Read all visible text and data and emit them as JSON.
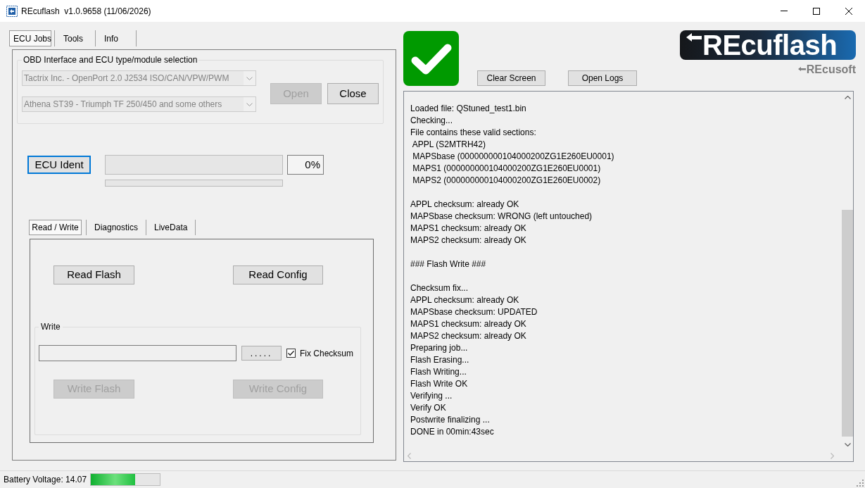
{
  "window": {
    "title": "REcuflash  v1.0.9658 (11/06/2026)"
  },
  "main_tabs": [
    {
      "label": "ECU Jobs",
      "selected": true
    },
    {
      "label": "Tools",
      "selected": false
    },
    {
      "label": "Info",
      "selected": false
    }
  ],
  "interface_group": {
    "title": "OBD Interface and ECU type/module selection",
    "dropdowns": [
      {
        "value": "Tactrix Inc. - OpenPort 2.0 J2534 ISO/CAN/VPW/PWM",
        "disabled": true
      },
      {
        "value": "Athena ST39 - Triumph TF 250/450 and some others",
        "disabled": true
      }
    ],
    "buttons": [
      {
        "label": "Open",
        "disabled": true
      },
      {
        "label": "Close",
        "disabled": false
      }
    ]
  },
  "ident": {
    "button": {
      "label": "ECU Ident",
      "focused": true
    },
    "progress": {
      "level": 0
    },
    "percent": "0%",
    "sub_progress": {
      "level": 0
    }
  },
  "job_tabs": [
    {
      "label": "Read / Write",
      "selected": true
    },
    {
      "label": "Diagnostics",
      "selected": false
    },
    {
      "label": "LiveData",
      "selected": false
    }
  ],
  "read_buttons": [
    {
      "label": "Read Flash",
      "disabled": false
    },
    {
      "label": "Read Config",
      "disabled": false
    }
  ],
  "write_group": {
    "title": "Write",
    "browse_button": {
      "label": "....."
    },
    "fix_checksum": {
      "label": "Fix Checksum",
      "checked": true
    },
    "buttons": [
      {
        "label": "Write Flash",
        "disabled": true
      },
      {
        "label": "Write Config",
        "disabled": true
      }
    ]
  },
  "status_icon": {
    "kind": "success"
  },
  "log_buttons": [
    {
      "label": "Clear Screen"
    },
    {
      "label": "Open Logs"
    }
  ],
  "logo": {
    "name": "REcuflash",
    "maker": "REcusoft"
  },
  "log": {
    "blocks": [
      [
        "Loaded file: QStuned_test1.bin",
        "Checking...",
        "File contains these valid sections:",
        " APPL (S2MTRH42)",
        " MAPSbase (000000000104000200ZG1E260EU0001)",
        " MAPS1 (000000000104000200ZG1E260EU0001)",
        " MAPS2 (000000000104000200ZG1E260EU0002)"
      ],
      [
        "APPL checksum: already OK",
        "MAPSbase checksum: WRONG (left untouched)",
        "MAPS1 checksum: already OK",
        "MAPS2 checksum: already OK"
      ],
      [
        "### Flash Write ###"
      ],
      [
        "Checksum fix...",
        "APPL checksum: already OK",
        "MAPSbase checksum: UPDATED",
        "MAPS1 checksum: already OK",
        "MAPS2 checksum: already OK",
        "Preparing job...",
        "Flash Erasing...",
        "Flash Writing...",
        "Flash Write OK",
        "Verifying ...",
        "Verify OK",
        "Postwrite finalizing ...",
        "DONE in 00min:43sec"
      ]
    ]
  },
  "status_bar": {
    "label": "Battery Voltage: 14.07",
    "battery": {
      "level": 0.64
    }
  }
}
